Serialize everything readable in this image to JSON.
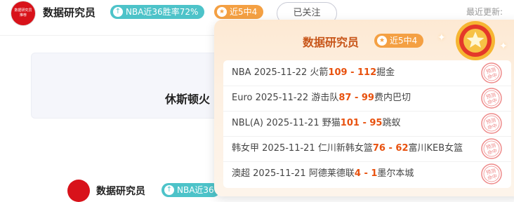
{
  "header": {
    "avatar_line1": "数据研究员",
    "avatar_line2": "推荐",
    "username": "数据研究员",
    "rate_badge": "NBA近36胜率72%",
    "streak_badge": "近5中4",
    "follow_label": "已关注",
    "last_update": "最近更新:"
  },
  "card": {
    "title": "休斯顿火"
  },
  "bottom": {
    "username": "数据研究员",
    "badge": "NBA近36"
  },
  "popup": {
    "title": "数据研究员",
    "badge": "近5中4",
    "stamp_text": "预测命中",
    "records": [
      {
        "league": "NBA",
        "date": "2025-11-22",
        "home": "火箭",
        "home_score": "109",
        "dash": " - ",
        "away_score": "112",
        "away": "掘金"
      },
      {
        "league": "Euro",
        "date": "2025-11-22",
        "home": "游击队",
        "home_score": "87",
        "dash": " - ",
        "away_score": "99",
        "away": "费内巴切"
      },
      {
        "league": "NBL(A)",
        "date": "2025-11-21",
        "home": "野猫",
        "home_score": "101",
        "dash": " - ",
        "away_score": "95",
        "away": "跳蚁"
      },
      {
        "league": "韩女甲",
        "date": "2025-11-21",
        "home": "仁川新韩女篮",
        "home_score": "76",
        "dash": " - ",
        "away_score": "62",
        "away": "富川KEB女篮"
      },
      {
        "league": "澳超",
        "date": "2025-11-21",
        "home": "阿德莱德联",
        "home_score": "4",
        "dash": " - ",
        "away_score": "1",
        "away": "墨尔本城"
      }
    ]
  },
  "colors": {
    "accent": "#e8510e",
    "teal": "#4dc3c9",
    "orange": "#f4a043",
    "title": "#c8561a"
  },
  "icons": {
    "rate": "trend-up-icon",
    "streak": "star-icon",
    "medal": "medal-icon",
    "stamp": "hit-stamp-icon"
  }
}
